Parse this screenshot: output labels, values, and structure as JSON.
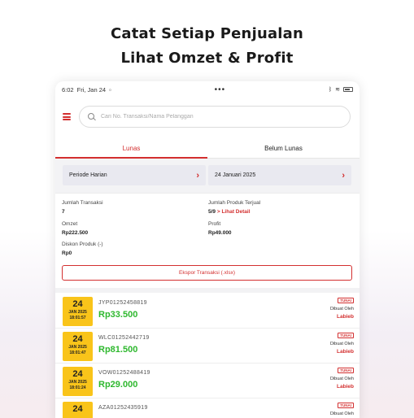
{
  "headline": {
    "line1": "Catat Setiap Penjualan",
    "line2": "Lihat Omzet & Profit"
  },
  "statusbar": {
    "time": "6:02",
    "date": "Fri, Jan 24",
    "dots": "•••"
  },
  "search": {
    "placeholder": "Cari No. Transaksi/Nama Pelanggan"
  },
  "tabs": [
    {
      "label": "Lunas",
      "active": true
    },
    {
      "label": "Belum Lunas",
      "active": false
    }
  ],
  "filters": {
    "period": "Periode Harian",
    "date": "24 Januari 2025"
  },
  "stats": {
    "jumlah_transaksi": {
      "label": "Jumlah Transaksi",
      "value": "7"
    },
    "jumlah_produk": {
      "label": "Jumlah Produk Terjual",
      "value": "5/9",
      "link": "> Lihat Detail"
    },
    "omzet": {
      "label": "Omzet",
      "value": "Rp222.500"
    },
    "profit": {
      "label": "Profit",
      "value": "Rp49.000"
    },
    "diskon": {
      "label": "Diskon Produk (-)",
      "value": "Rp0"
    }
  },
  "export_label": "Ekspor Transaksi (.xlsx)",
  "transactions": [
    {
      "day": "24",
      "month": "JAN 2025",
      "time": "18:01:57",
      "id": "JYP01252458819",
      "amount": "Rp33.500",
      "badge": "TUNAI",
      "by_label": "Dibuat Oleh",
      "user": "Labieb"
    },
    {
      "day": "24",
      "month": "JAN 2025",
      "time": "18:01:47",
      "id": "WLC01252442719",
      "amount": "Rp81.500",
      "badge": "TUNAI",
      "by_label": "Dibuat Oleh",
      "user": "Labieb"
    },
    {
      "day": "24",
      "month": "JAN 2025",
      "time": "18:01:24",
      "id": "VOW01252488419",
      "amount": "Rp29.000",
      "badge": "TUNAI",
      "by_label": "Dibuat Oleh",
      "user": "Labieb"
    },
    {
      "day": "24",
      "month": "",
      "time": "",
      "id": "AZA01252435919",
      "amount": "",
      "badge": "TUNAI",
      "by_label": "Dibuat Oleh",
      "user": ""
    }
  ],
  "colors": {
    "accent": "#d32f2f",
    "date_badge": "#f9c41a",
    "amount": "#2eb82e"
  }
}
